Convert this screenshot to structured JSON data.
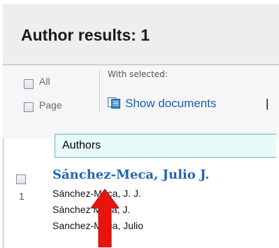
{
  "header": {
    "title": "Author results: 1"
  },
  "toolbar": {
    "all_label": "All",
    "page_label": "Page",
    "with_selected_label": "With selected:",
    "show_documents_label": "Show documents",
    "separator": "|",
    "show_documents_icon": "documents-icon"
  },
  "table": {
    "column_header": "Authors"
  },
  "results": [
    {
      "number": "1",
      "name": "Sánchez-Meca, Julio J.",
      "variants": [
        "Sánchez-Meca, J. J.",
        "Sánchez Meca, J.",
        "Sanchez-Meca, Julio"
      ]
    }
  ],
  "colors": {
    "link": "#2265b5",
    "column_header_bg": "#e6fbfa",
    "column_header_border": "#6db6b2",
    "header_bg": "#eeeeee",
    "annotation_arrow": "#e8140c"
  }
}
